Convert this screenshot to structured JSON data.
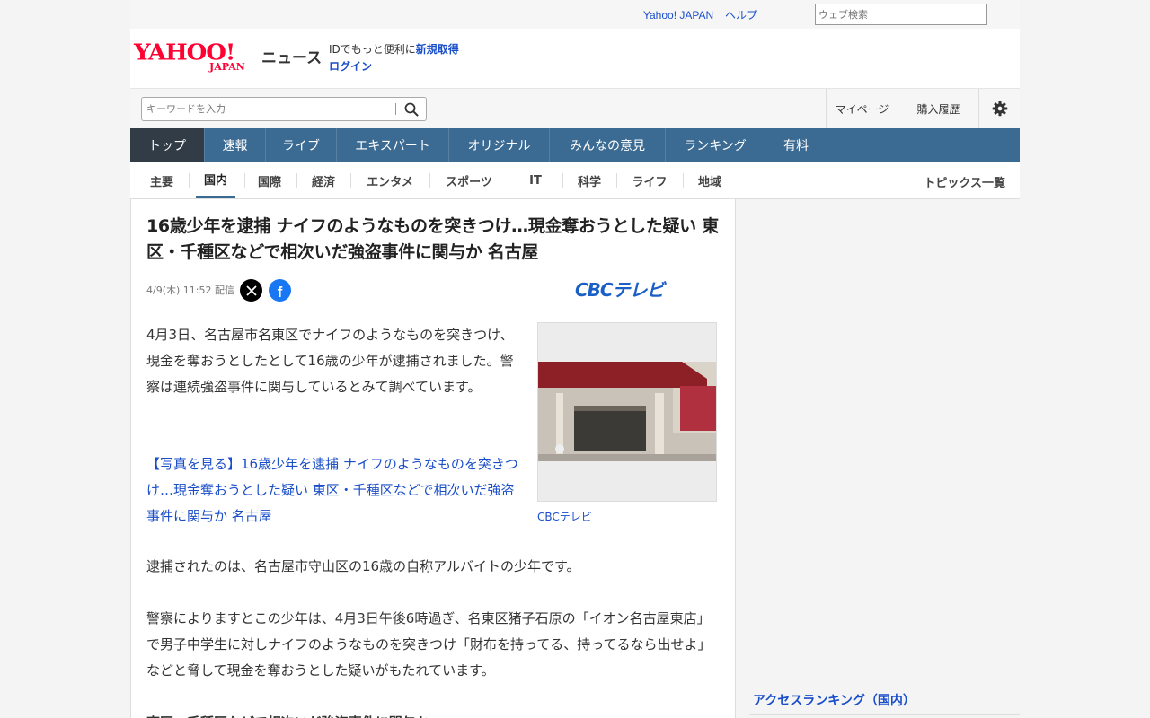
{
  "topbar": {
    "yahoo_japan": "Yahoo! JAPAN",
    "help": "ヘルプ",
    "web_search_placeholder": "ウェブ検索"
  },
  "logo": {
    "yahoo": "YAHOO!",
    "japan": "JAPAN",
    "news": "ニュース"
  },
  "id_promo": {
    "text": "IDでもっと便利に",
    "register": "新規取得",
    "login": "ログイン"
  },
  "search": {
    "placeholder": "キーワードを入力"
  },
  "utility": {
    "mypage": "マイページ",
    "purchase_history": "購入履歴"
  },
  "nav": {
    "items": [
      "トップ",
      "速報",
      "ライブ",
      "エキスパート",
      "オリジナル",
      "みんなの意見",
      "ランキング",
      "有料"
    ],
    "active": "トップ"
  },
  "subnav": {
    "items": [
      "主要",
      "国内",
      "国際",
      "経済",
      "エンタメ",
      "スポーツ",
      "IT",
      "科学",
      "ライフ",
      "地域"
    ],
    "active": "国内",
    "topics": "トピックス一覧"
  },
  "article": {
    "title": "16歳少年を逮捕 ナイフのようなものを突きつけ…現金奪おうとした疑い 東区・千種区などで相次いだ強盗事件に関与か 名古屋",
    "date": "4/9(木) 11:52",
    "delivered": "配信",
    "source_logo": "CBCテレビ",
    "paragraph1": "4月3日、名古屋市名東区でナイフのようなものを突きつけ、現金を奪おうとしたとして16歳の少年が逮捕されました。警察は連続強盗事件に関与しているとみて調べています。",
    "photo_link": "【写真を見る】16歳少年を逮捕 ナイフのようなものを突きつけ…現金奪おうとした疑い 東区・千種区などで相次いだ強盗事件に関与か 名古屋",
    "photo_caption": "CBCテレビ",
    "paragraph2": "逮捕されたのは、名古屋市守山区の16歳の自称アルバイトの少年です。",
    "paragraph3": "警察によりますとこの少年は、4月3日午後6時過ぎ、名東区猪子石原の「イオン名古屋東店」で男子中学生に対しナイフのようなものを突きつけ「財布を持ってる、持ってるなら出せよ」などと脅して現金を奪おうとした疑いがもたれています。",
    "paragraph4": "東区・千種区などで相次いだ強盗事件に関与か"
  },
  "sidebar": {
    "access_ranking": "アクセスランキング（国内）"
  },
  "colors": {
    "brand_red": "#ff0033",
    "nav_blue": "#3b6a92",
    "nav_active": "#313c47",
    "link_blue": "#1a4ec9",
    "cbc_blue": "#1a5fc6"
  }
}
